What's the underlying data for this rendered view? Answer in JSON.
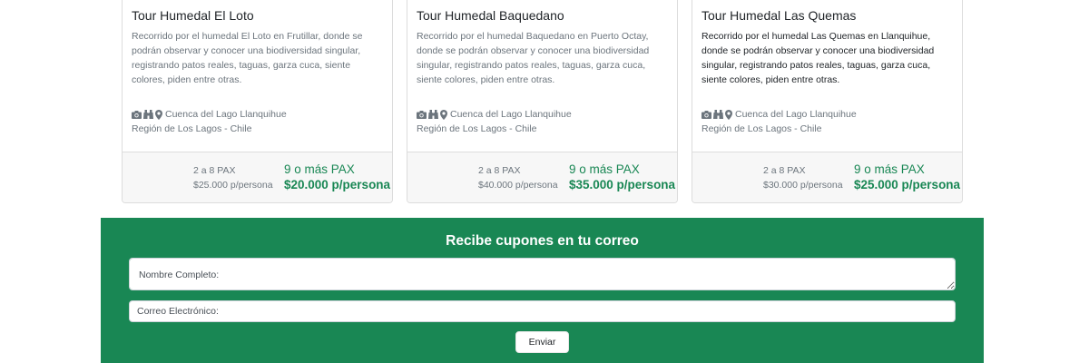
{
  "tours": [
    {
      "title": "Tour Humedal El Loto",
      "description": "Recorrido por el humedal El Loto en Frutillar, donde se podrán observar y conocer una biodiversidad singular, registrando patos reales, taguas, garza cuca, siente colores, piden entre otras.",
      "location": "Cuenca del Lago Llanquihue",
      "region": "Región de Los Lagos - Chile",
      "group_small_label": "2 a 8 PAX",
      "group_small_price": "$25.000 p/persona",
      "group_large_label": "9 o más PAX",
      "group_large_price": "$20.000 p/persona"
    },
    {
      "title": "Tour Humedal Baquedano",
      "description": "Recorrido por el humedal Baquedano en Puerto Octay, donde se podrán observar y conocer una biodiversidad singular, registrando patos reales, taguas, garza cuca, siente colores, piden entre otras.",
      "location": "Cuenca del Lago Llanquihue",
      "region": "Región de Los Lagos - Chile",
      "group_small_label": "2 a 8 PAX",
      "group_small_price": "$40.000 p/persona",
      "group_large_label": "9 o más PAX",
      "group_large_price": "$35.000 p/persona"
    },
    {
      "title": "Tour Humedal Las Quemas",
      "description": "Recorrido por el humedal Las Quemas en Llanquihue, donde se podrán observar y conocer una biodiversidad singular, registrando patos reales, taguas, garza cuca, siente colores, piden entre otras.",
      "location": "Cuenca del Lago Llanquihue",
      "region": "Región de Los Lagos - Chile",
      "group_small_label": "2 a 8 PAX",
      "group_small_price": "$30.000 p/persona",
      "group_large_label": "9 o más PAX",
      "group_large_price": "$25.000 p/persona"
    }
  ],
  "card_icons": [
    "camera-icon",
    "binoculars-icon",
    "map-marker-icon"
  ],
  "newsletter": {
    "title": "Recibe cupones en tu correo",
    "name_placeholder": "Nombre Completo:",
    "email_placeholder": "Correo Electrónico:",
    "submit_label": "Enviar"
  },
  "colors": {
    "brand_green": "#198754",
    "muted_text": "#6c757d"
  }
}
